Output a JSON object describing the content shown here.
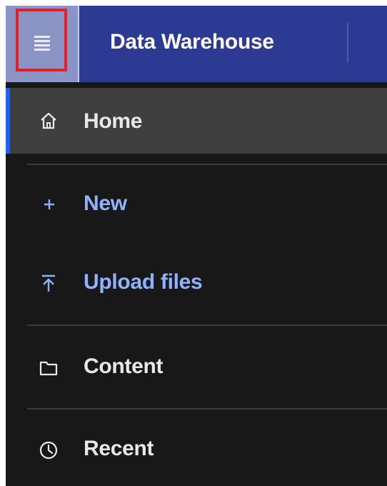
{
  "header": {
    "menu_icon": "hamburger-menu-icon",
    "title": "Data Warehouse"
  },
  "nav": {
    "items": [
      {
        "label": "Home",
        "icon": "home-icon",
        "active": true
      },
      {
        "label": "New",
        "icon": "plus-icon",
        "accent": true
      },
      {
        "label": "Upload files",
        "icon": "upload-icon",
        "accent": true
      },
      {
        "label": "Content",
        "icon": "folder-icon"
      },
      {
        "label": "Recent",
        "icon": "clock-icon"
      }
    ]
  },
  "colors": {
    "header_bg": "#2c3a93",
    "menu_button_bg": "#8a95c6",
    "highlight_border": "#e3202a",
    "sidebar_bg": "#181818",
    "active_item_bg": "#3f3f3f",
    "active_indicator": "#1f5fff",
    "accent_text": "#8fb2ff",
    "text": "#e8e8e8"
  }
}
